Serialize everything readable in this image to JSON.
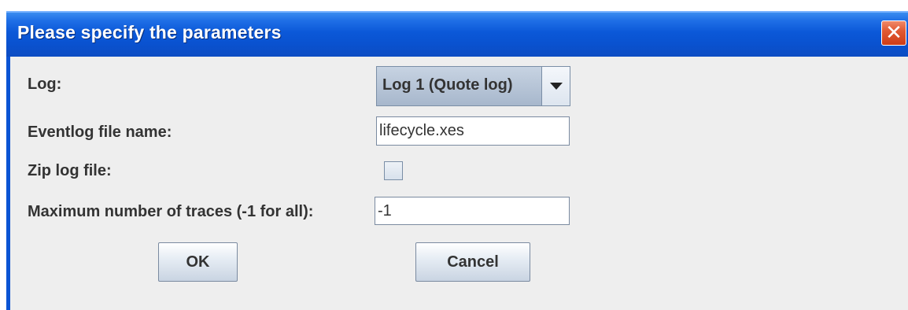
{
  "window": {
    "title": "Please specify the parameters",
    "close_symbol": "✕"
  },
  "form": {
    "log_label": "Log:",
    "log_selected": "Log 1 (Quote log)",
    "filename_label": "Eventlog file name:",
    "filename_value": "lifecycle.xes",
    "zip_label": "Zip log file:",
    "zip_checked": false,
    "max_traces_label": "Maximum number of traces (-1 for all):",
    "max_traces_value": "-1"
  },
  "buttons": {
    "ok_label": "OK",
    "cancel_label": "Cancel"
  },
  "colors": {
    "title_bar": "#0a52d0",
    "close_button": "#e15a33",
    "dialog_background": "#eeeeee"
  },
  "icons": {
    "close": "close-icon",
    "dropdown": "chevron-down-icon"
  }
}
